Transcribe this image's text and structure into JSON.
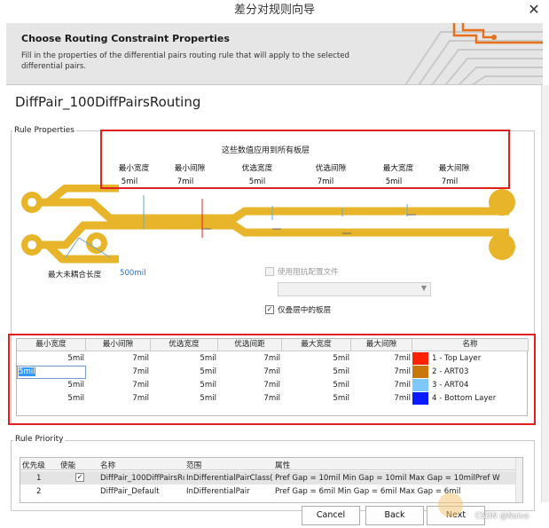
{
  "window": {
    "title": "差分对规则向导",
    "close_glyph": "✕"
  },
  "header": {
    "title": "Choose Routing Constraint Properties",
    "description": "Fill in the properties of the differential pairs routing rule that will apply to the selected differential pairs."
  },
  "rule_name": "DiffPair_100DiffPairsRouting",
  "rule_properties": {
    "group_label": "Rule Properties",
    "all_layers_note": "这些数值应用到所有板层",
    "columns": [
      {
        "label": "最小宽度",
        "value": "5mil"
      },
      {
        "label": "最小间隙",
        "value": "7mil"
      },
      {
        "label": "优选宽度",
        "value": "5mil"
      },
      {
        "label": "优选间隙",
        "value": "7mil"
      },
      {
        "label": "最大宽度",
        "value": "5mil"
      },
      {
        "label": "最大间隙",
        "value": "7mil"
      }
    ],
    "max_uncoupled_label": "最大未耦合长度",
    "max_uncoupled_value": "500mil",
    "use_impedance_label": "使用阻抗配置文件",
    "impedance_select_value": "",
    "stacked_layers_label": "仅叠层中的板层",
    "stacked_layers_checked": true
  },
  "layer_table": {
    "headers": [
      "最小宽度",
      "最小间隙",
      "优选宽度",
      "优选间距",
      "最大宽度",
      "最大间隙",
      "名称"
    ],
    "rows": [
      {
        "min_w": "5mil",
        "min_gap": "7mil",
        "pref_w": "5mil",
        "pref_gap": "7mil",
        "max_w": "5mil",
        "max_gap": "7mil",
        "name": "1 - Top Layer",
        "color": "#ff2200"
      },
      {
        "min_w": "5mil",
        "min_gap": "7mil",
        "pref_w": "5mil",
        "pref_gap": "7mil",
        "max_w": "5mil",
        "max_gap": "7mil",
        "name": "2 - ART03",
        "color": "#c8770c"
      },
      {
        "min_w": "5mil",
        "min_gap": "7mil",
        "pref_w": "5mil",
        "pref_gap": "7mil",
        "max_w": "5mil",
        "max_gap": "7mil",
        "name": "3 - ART04",
        "color": "#7ec8ff"
      },
      {
        "min_w": "5mil",
        "min_gap": "7mil",
        "pref_w": "5mil",
        "pref_gap": "7mil",
        "max_w": "5mil",
        "max_gap": "7mil",
        "name": "4 - Bottom Layer",
        "color": "#0a1cff"
      }
    ],
    "editing_value": "5mil"
  },
  "rule_priority": {
    "group_label": "Rule Priority",
    "headers": [
      "优先级",
      "使能",
      "名称",
      "范围",
      "属性"
    ],
    "rows": [
      {
        "priority": "1",
        "enabled": true,
        "name": "DiffPair_100DiffPairsRc",
        "scope": "InDifferentialPairClass(",
        "props": "Pref Gap = 10mil   Min Gap  = 10mil   Max Gap  = 10milPref W"
      },
      {
        "priority": "2",
        "enabled": true,
        "name": "DiffPair_Default",
        "scope": "InDifferentialPair",
        "props": "Pref Gap = 6mil   Min Gap = 6mil   Max Gap = 6mil"
      }
    ]
  },
  "buttons": {
    "cancel": "Cancel",
    "back": "Back",
    "next": "Next"
  },
  "watermark": "CSDN @Naiva",
  "colors": {
    "trace": "#e8b52a",
    "highlight": "#e02020",
    "link": "#2f6fbf"
  }
}
